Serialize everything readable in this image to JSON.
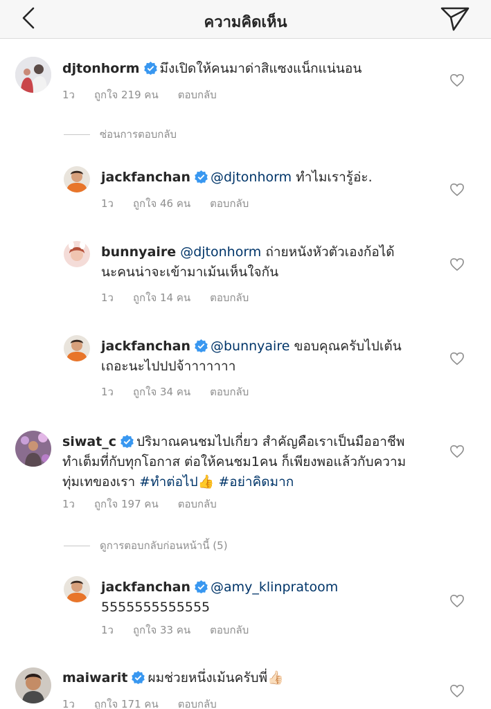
{
  "header": {
    "title": "ความคิดเห็น",
    "back_icon": "chevron-left-icon",
    "send_icon": "paper-plane-icon"
  },
  "colors": {
    "mention": "#003569",
    "meta": "#8e8e8e",
    "verified": "#3897f0"
  },
  "comments": [
    {
      "username": "djtonhorm",
      "text": "มึงเปิดให้คนมาด่าสิแซงแน็กแน่นอน",
      "time": "1ว",
      "likes": "ถูกใจ 219 คน",
      "reply": "ตอบกลับ"
    },
    {
      "username": "jackfanchan",
      "mention": "@djtonhorm",
      "text": "ทำไมเรารู้อ่ะ.",
      "time": "1ว",
      "likes": "ถูกใจ 46 คน",
      "reply": "ตอบกลับ"
    },
    {
      "username": "bunnyaire",
      "mention": "@djtonhorm",
      "text1": "ถ่ายหนังหัวตัวเองก้อได้",
      "text2": "นะคนน่าจะเข้ามาเม้นเห็นใจกัน",
      "time": "1ว",
      "likes": "ถูกใจ 14 คน",
      "reply": "ตอบกลับ"
    },
    {
      "username": "jackfanchan",
      "mention": "@bunnyaire",
      "text1": "ขอบคุณครับไปเต้น",
      "text2": "เถอะนะไปปปจ้าาาาาาา",
      "time": "1ว",
      "likes": "ถูกใจ 34 คน",
      "reply": "ตอบกลับ"
    },
    {
      "username": "siwat_c",
      "text1": "ปริมาณคนชมไปเกี่ยว สำคัญคือเราเป็นมืออาชีพ",
      "text2": "ทำเต็มที่กับทุกโอกาส ต่อให้คนชม1คน ก็เพียงพอแล้วกับความ",
      "text3": "ทุ่มเทของเรา",
      "hashtag1": "#ทำต่อไป",
      "emoji1": "👍",
      "hashtag2": "#อย่าคิดมาก",
      "time": "1ว",
      "likes": "ถูกใจ 197 คน",
      "reply": "ตอบกลับ"
    },
    {
      "username": "jackfanchan",
      "mention": "@amy_klinpratoom",
      "text": "5555555555555",
      "time": "1ว",
      "likes": "ถูกใจ 33 คน",
      "reply": "ตอบกลับ"
    },
    {
      "username": "maiwarit",
      "text": "ผมช่วยหนึ่งเม้นครับพี่",
      "emoji": "👍🏻",
      "time": "1ว",
      "likes": "ถูกใจ 171 คน",
      "reply": "ตอบกลับ"
    }
  ],
  "threads": {
    "hide_replies": "ซ่อนการตอบกลับ",
    "view_previous": "ดูการตอบกลับก่อนหน้านี้ (5)"
  }
}
